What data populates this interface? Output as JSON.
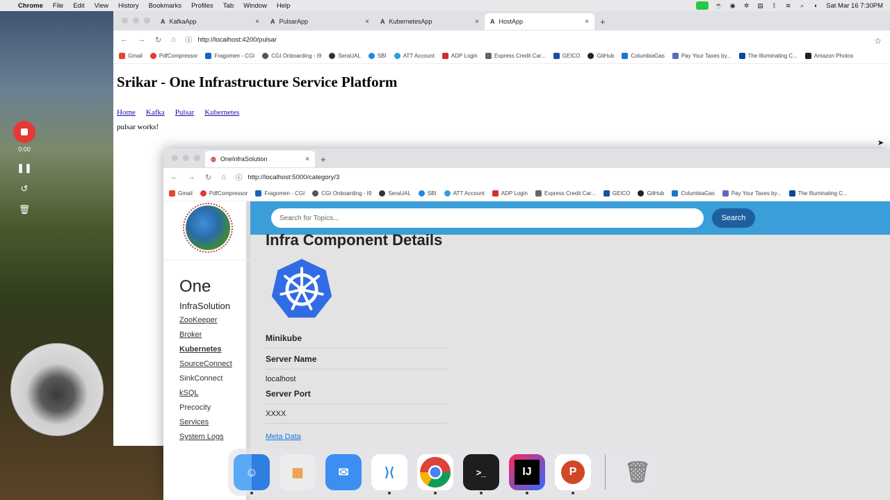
{
  "menubar": {
    "app": "Chrome",
    "items": [
      "File",
      "Edit",
      "View",
      "History",
      "Bookmarks",
      "Profiles",
      "Tab",
      "Window",
      "Help"
    ],
    "datetime": "Sat Mar 16  7:30PM"
  },
  "back_window": {
    "tabs": [
      {
        "label": "KafkaApp",
        "icon": "angular-icon"
      },
      {
        "label": "PulsarApp",
        "icon": "angular-icon"
      },
      {
        "label": "KubernetesApp",
        "icon": "angular-icon"
      },
      {
        "label": "HostApp",
        "icon": "angular-icon"
      }
    ],
    "url": "http://localhost:4200/pulsar",
    "bookmarks": [
      "Gmail",
      "PdfCompressor",
      "Fragomen - CGI",
      "CGI Onboarding - I9",
      "SeraUAL",
      "SBI",
      "ATT Account",
      "ADP Login",
      "Express Credit Car...",
      "GEICO",
      "GitHub",
      "ColumbiaGas",
      "Pay Your Taxes by...",
      "The Illuminating C...",
      "Amazon Photos"
    ],
    "page_title": "Srikar - One Infrastructure Service Platform",
    "nav": [
      "Home",
      "Kafka",
      "Pulsar",
      "Kubernetes"
    ],
    "message": "pulsar works!"
  },
  "front_window": {
    "tab_label": "OneInfraSolution",
    "url": "http://localhost:5000/category/3",
    "bookmarks": [
      "Gmail",
      "PdfCompressor",
      "Fragomen - CGI",
      "CGI Onboarding - I9",
      "SeraUAL",
      "SBI",
      "ATT Account",
      "ADP Login",
      "Express Credit Car...",
      "GEICO",
      "GitHub",
      "ColumbiaGas",
      "Pay Your Taxes by...",
      "The Illuminating C..."
    ],
    "sidebar": {
      "brand_main": "One",
      "brand_sub": "InfraSolution",
      "items": [
        {
          "label": "ZooKeeper",
          "link": true,
          "active": false
        },
        {
          "label": "Broker",
          "link": true,
          "active": false
        },
        {
          "label": "Kubernetes",
          "link": true,
          "active": true
        },
        {
          "label": "SourceConnect",
          "link": true,
          "active": false
        },
        {
          "label": "SinkConnect",
          "link": false,
          "active": false
        },
        {
          "label": "kSQL",
          "link": true,
          "active": false
        },
        {
          "label": "Precocity",
          "link": false,
          "active": false
        },
        {
          "label": "Services",
          "link": true,
          "active": false
        },
        {
          "label": "System Logs",
          "link": true,
          "active": false
        }
      ]
    },
    "search": {
      "placeholder": "Search for Topics...",
      "button": "Search"
    },
    "details": {
      "title": "Infra Component Details",
      "component": "Minikube",
      "server_name_label": "Server Name",
      "server_name_value": "localhost",
      "server_port_label": "Server Port",
      "server_port_value": "XXXX",
      "meta_link": "Meta Data"
    }
  },
  "recorder": {
    "time": "0:00"
  },
  "dock": [
    {
      "name": "finder",
      "color": "#3d8ef0"
    },
    {
      "name": "launchpad",
      "color": "#eaeaea"
    },
    {
      "name": "mail",
      "color": "#3c8ff0"
    },
    {
      "name": "vscode",
      "color": "#ffffff"
    },
    {
      "name": "chrome",
      "color": "#ffffff"
    },
    {
      "name": "terminal",
      "color": "#1e1e1e"
    },
    {
      "name": "intellij",
      "color": "#111111"
    },
    {
      "name": "powerpoint",
      "color": "#ffffff"
    },
    {
      "name": "trash",
      "color": "#d8d8d8"
    }
  ]
}
